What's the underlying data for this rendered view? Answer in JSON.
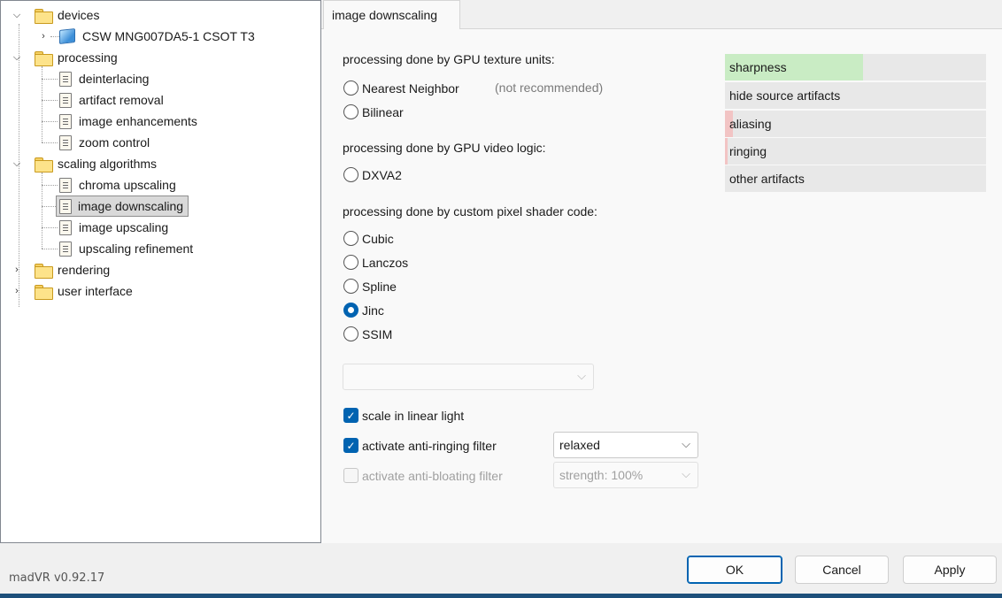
{
  "tree": {
    "devices": "devices",
    "device_item": "CSW MNG007DA5-1 CSOT T3",
    "processing": "processing",
    "processing_items": [
      "deinterlacing",
      "artifact removal",
      "image enhancements",
      "zoom control"
    ],
    "scaling": "scaling algorithms",
    "scaling_items": [
      "chroma upscaling",
      "image downscaling",
      "image upscaling",
      "upscaling refinement"
    ],
    "selected": "image downscaling",
    "rendering": "rendering",
    "user_interface": "user interface"
  },
  "tab": {
    "label": "image downscaling"
  },
  "content": {
    "gpu_texture_heading": "processing done by GPU texture units:",
    "nearest_neighbor": "Nearest Neighbor",
    "not_recommended": "(not recommended)",
    "bilinear": "Bilinear",
    "gpu_video_heading": "processing done by GPU video logic:",
    "dxva2": "DXVA2",
    "shader_heading": "processing done by custom pixel shader code:",
    "algorithms": [
      "Cubic",
      "Lanczos",
      "Spline",
      "Jinc",
      "SSIM"
    ],
    "selected_algorithm": "Jinc",
    "algo_combo_value": "",
    "linear_light": {
      "label": "scale in linear light",
      "checked": true
    },
    "anti_ringing": {
      "label": "activate anti-ringing filter",
      "checked": true,
      "value": "relaxed"
    },
    "anti_bloating": {
      "label": "activate anti-bloating filter",
      "checked": false,
      "enabled": false,
      "value": "strength: 100%"
    }
  },
  "quality": [
    {
      "label": "sharpness",
      "level": 0.53,
      "color": "#c9ecc4"
    },
    {
      "label": "hide source artifacts",
      "level": 0.0,
      "color": "#c9ecc4"
    },
    {
      "label": "aliasing",
      "level": 0.03,
      "color": "#f2c4c4"
    },
    {
      "label": "ringing",
      "level": 0.01,
      "color": "#f2c4c4"
    },
    {
      "label": "other artifacts",
      "level": 0.0,
      "color": "#f2c4c4"
    }
  ],
  "footer": {
    "version": "madVR v0.92.17",
    "ok": "OK",
    "cancel": "Cancel",
    "apply": "Apply"
  },
  "colors": {
    "accent": "#0063b1",
    "selection": "#d9d9d9"
  }
}
